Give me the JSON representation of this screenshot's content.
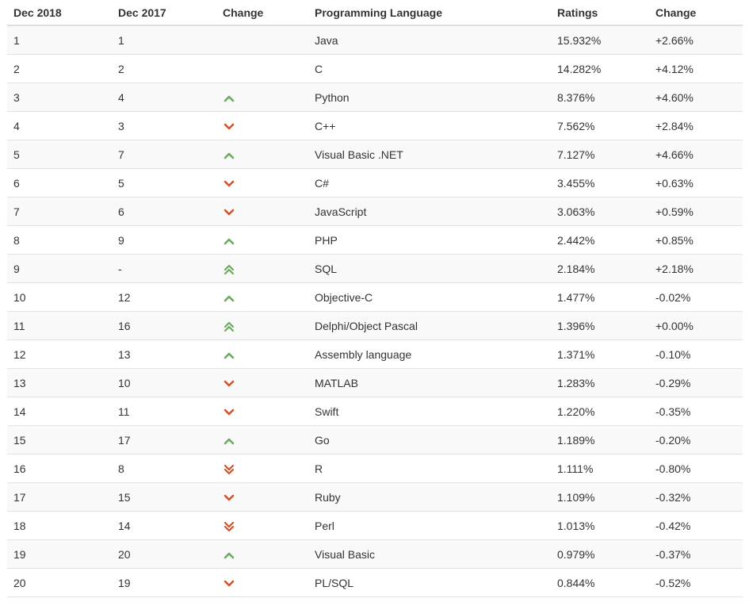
{
  "table": {
    "headers": [
      "Dec 2018",
      "Dec 2017",
      "Change",
      "Programming Language",
      "Ratings",
      "Change"
    ],
    "rows": [
      {
        "dec2018": "1",
        "dec2017": "1",
        "change_icon": "none",
        "language": "Java",
        "rating": "15.932%",
        "change": "+2.66%"
      },
      {
        "dec2018": "2",
        "dec2017": "2",
        "change_icon": "none",
        "language": "C",
        "rating": "14.282%",
        "change": "+4.12%"
      },
      {
        "dec2018": "3",
        "dec2017": "4",
        "change_icon": "up",
        "language": "Python",
        "rating": "8.376%",
        "change": "+4.60%"
      },
      {
        "dec2018": "4",
        "dec2017": "3",
        "change_icon": "down",
        "language": "C++",
        "rating": "7.562%",
        "change": "+2.84%"
      },
      {
        "dec2018": "5",
        "dec2017": "7",
        "change_icon": "up",
        "language": "Visual Basic .NET",
        "rating": "7.127%",
        "change": "+4.66%"
      },
      {
        "dec2018": "6",
        "dec2017": "5",
        "change_icon": "down",
        "language": "C#",
        "rating": "3.455%",
        "change": "+0.63%"
      },
      {
        "dec2018": "7",
        "dec2017": "6",
        "change_icon": "down",
        "language": "JavaScript",
        "rating": "3.063%",
        "change": "+0.59%"
      },
      {
        "dec2018": "8",
        "dec2017": "9",
        "change_icon": "up",
        "language": "PHP",
        "rating": "2.442%",
        "change": "+0.85%"
      },
      {
        "dec2018": "9",
        "dec2017": "-",
        "change_icon": "double-up",
        "language": "SQL",
        "rating": "2.184%",
        "change": "+2.18%"
      },
      {
        "dec2018": "10",
        "dec2017": "12",
        "change_icon": "up",
        "language": "Objective-C",
        "rating": "1.477%",
        "change": "-0.02%"
      },
      {
        "dec2018": "11",
        "dec2017": "16",
        "change_icon": "double-up",
        "language": "Delphi/Object Pascal",
        "rating": "1.396%",
        "change": "+0.00%"
      },
      {
        "dec2018": "12",
        "dec2017": "13",
        "change_icon": "up",
        "language": "Assembly language",
        "rating": "1.371%",
        "change": "-0.10%"
      },
      {
        "dec2018": "13",
        "dec2017": "10",
        "change_icon": "down",
        "language": "MATLAB",
        "rating": "1.283%",
        "change": "-0.29%"
      },
      {
        "dec2018": "14",
        "dec2017": "11",
        "change_icon": "down",
        "language": "Swift",
        "rating": "1.220%",
        "change": "-0.35%"
      },
      {
        "dec2018": "15",
        "dec2017": "17",
        "change_icon": "up",
        "language": "Go",
        "rating": "1.189%",
        "change": "-0.20%"
      },
      {
        "dec2018": "16",
        "dec2017": "8",
        "change_icon": "double-down",
        "language": "R",
        "rating": "1.111%",
        "change": "-0.80%"
      },
      {
        "dec2018": "17",
        "dec2017": "15",
        "change_icon": "down",
        "language": "Ruby",
        "rating": "1.109%",
        "change": "-0.32%"
      },
      {
        "dec2018": "18",
        "dec2017": "14",
        "change_icon": "double-down",
        "language": "Perl",
        "rating": "1.013%",
        "change": "-0.42%"
      },
      {
        "dec2018": "19",
        "dec2017": "20",
        "change_icon": "up",
        "language": "Visual Basic",
        "rating": "0.979%",
        "change": "-0.37%"
      },
      {
        "dec2018": "20",
        "dec2017": "19",
        "change_icon": "down",
        "language": "PL/SQL",
        "rating": "0.844%",
        "change": "-0.52%"
      }
    ]
  },
  "colors": {
    "up": "#6aab5c",
    "down": "#d2532a",
    "row_alt": "#f9f9f9",
    "border": "#e3e3e3"
  }
}
